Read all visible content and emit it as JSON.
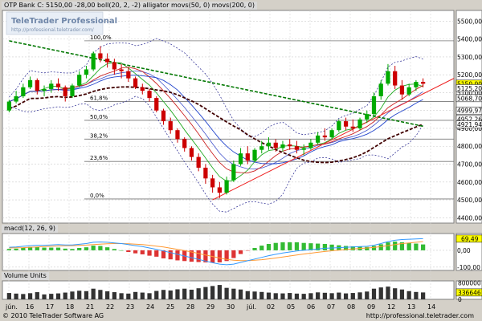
{
  "price_header": "OTP Bank C: 5150,00 -28,00 boll(20, 2, -2) alligator movs(50, 0) movs(200, 0)",
  "macd_header": "macd(12, 26, 9)",
  "volume_header": "Volume Units",
  "watermark": {
    "title": "TeleTrader Professional",
    "subtitle": "http://professional.teletrader.com/"
  },
  "footer": {
    "left": "© 2010 TeleTrader Software AG",
    "right": "http://professional.teletrader.com"
  },
  "colors": {
    "background": "#d4d0c8",
    "pane": "#ffffff",
    "candle_up": "#00aa00",
    "candle_down": "#cc0000",
    "bollinger": "#3a3a9a",
    "movs50": "#400000",
    "movs200": "#007700",
    "trendline": "#ee2222",
    "macd_line": "#3399ff",
    "signal_line": "#ff9933",
    "price_label": "#ffff00"
  },
  "chart_data": [
    {
      "type": "candlestick",
      "x_tick_labels": [
        "jún.",
        "16",
        "17",
        "18",
        "21",
        "22",
        "23",
        "24",
        "25",
        "28",
        "29",
        "30",
        "júl.",
        "02",
        "05",
        "06",
        "07",
        "08",
        "09",
        "12",
        "13",
        "14"
      ],
      "y_ticks": [
        4400,
        4500,
        4600,
        4700,
        4800,
        4900,
        5000,
        5100,
        5200,
        5300,
        5400,
        5500
      ],
      "y_tick_labels": [
        "4400,00",
        "4500,00",
        "4600,00",
        "4700,00",
        "4800,00",
        "4900,00",
        "5000,00",
        "5100,00",
        "5200,00",
        "5300,00",
        "5400,00",
        "5500,00"
      ],
      "ylim": [
        4370,
        5560
      ],
      "price_labels": [
        {
          "text": "5150,00",
          "value": 5150
        },
        {
          "text": "5125,20",
          "value": 5125
        },
        {
          "text": "5068,70",
          "value": 5069
        },
        {
          "text": "4999,97",
          "value": 5000
        },
        {
          "text": "4952,26",
          "value": 4952
        },
        {
          "text": "4921,94",
          "value": 4922
        }
      ],
      "fibonacci": [
        {
          "label": "100,0%",
          "value": 5390
        },
        {
          "label": "61,8%",
          "value": 5050
        },
        {
          "label": "50,0%",
          "value": 4945
        },
        {
          "label": "38,2%",
          "value": 4840
        },
        {
          "label": "23,6%",
          "value": 4715
        },
        {
          "label": "0,0%",
          "value": 4505
        }
      ],
      "candles": [
        [
          5000,
          5060,
          4990,
          5050
        ],
        [
          5050,
          5110,
          5040,
          5080
        ],
        [
          5080,
          5150,
          5070,
          5130
        ],
        [
          5130,
          5190,
          5120,
          5170
        ],
        [
          5170,
          5180,
          5090,
          5110
        ],
        [
          5110,
          5140,
          5080,
          5120
        ],
        [
          5120,
          5170,
          5100,
          5150
        ],
        [
          5150,
          5180,
          5110,
          5130
        ],
        [
          5130,
          5140,
          5050,
          5080
        ],
        [
          5080,
          5150,
          5070,
          5140
        ],
        [
          5140,
          5220,
          5130,
          5200
        ],
        [
          5200,
          5250,
          5180,
          5230
        ],
        [
          5230,
          5330,
          5220,
          5320
        ],
        [
          5320,
          5360,
          5270,
          5290
        ],
        [
          5290,
          5320,
          5240,
          5270
        ],
        [
          5270,
          5290,
          5200,
          5230
        ],
        [
          5230,
          5260,
          5180,
          5220
        ],
        [
          5220,
          5240,
          5160,
          5180
        ],
        [
          5180,
          5190,
          5120,
          5130
        ],
        [
          5130,
          5150,
          5090,
          5110
        ],
        [
          5110,
          5120,
          5050,
          5070
        ],
        [
          5070,
          5080,
          4990,
          5000
        ],
        [
          5000,
          5010,
          4920,
          4940
        ],
        [
          4940,
          4960,
          4870,
          4890
        ],
        [
          4890,
          4900,
          4820,
          4840
        ],
        [
          4840,
          4850,
          4770,
          4790
        ],
        [
          4790,
          4800,
          4720,
          4740
        ],
        [
          4740,
          4760,
          4660,
          4680
        ],
        [
          4680,
          4700,
          4590,
          4620
        ],
        [
          4620,
          4640,
          4540,
          4570
        ],
        [
          4570,
          4600,
          4510,
          4540
        ],
        [
          4540,
          4630,
          4530,
          4610
        ],
        [
          4610,
          4720,
          4600,
          4700
        ],
        [
          4700,
          4790,
          4690,
          4760
        ],
        [
          4760,
          4800,
          4700,
          4720
        ],
        [
          4720,
          4790,
          4710,
          4780
        ],
        [
          4780,
          4830,
          4760,
          4800
        ],
        [
          4800,
          4850,
          4780,
          4820
        ],
        [
          4820,
          4840,
          4770,
          4790
        ],
        [
          4790,
          4830,
          4770,
          4810
        ],
        [
          4810,
          4840,
          4780,
          4800
        ],
        [
          4800,
          4830,
          4760,
          4780
        ],
        [
          4780,
          4810,
          4750,
          4790
        ],
        [
          4790,
          4840,
          4780,
          4820
        ],
        [
          4820,
          4880,
          4810,
          4860
        ],
        [
          4860,
          4900,
          4830,
          4850
        ],
        [
          4850,
          4900,
          4840,
          4890
        ],
        [
          4890,
          4950,
          4880,
          4940
        ],
        [
          4940,
          4960,
          4890,
          4910
        ],
        [
          4910,
          4950,
          4880,
          4900
        ],
        [
          4900,
          4960,
          4890,
          4950
        ],
        [
          4950,
          5000,
          4930,
          4980
        ],
        [
          4980,
          5100,
          4970,
          5080
        ],
        [
          5080,
          5170,
          5060,
          5150
        ],
        [
          5150,
          5260,
          5140,
          5220
        ],
        [
          5220,
          5250,
          5120,
          5140
        ],
        [
          5140,
          5170,
          5060,
          5090
        ],
        [
          5090,
          5150,
          5080,
          5130
        ],
        [
          5130,
          5170,
          5110,
          5160
        ],
        [
          5160,
          5180,
          5130,
          5150
        ]
      ]
    },
    {
      "type": "macd",
      "y_ticks": [
        -100,
        0
      ],
      "y_tick_labels": [
        "-100,00",
        "0,00"
      ],
      "ylim": [
        -120,
        100
      ],
      "last_value_label": "69,49",
      "last_value": 69.49,
      "macd": [
        18,
        20,
        24,
        28,
        30,
        30,
        32,
        34,
        32,
        32,
        36,
        40,
        48,
        50,
        48,
        44,
        40,
        34,
        28,
        22,
        14,
        6,
        -4,
        -14,
        -24,
        -34,
        -44,
        -54,
        -64,
        -74,
        -82,
        -86,
        -82,
        -72,
        -62,
        -52,
        -42,
        -32,
        -24,
        -16,
        -10,
        -4,
        0,
        4,
        8,
        12,
        14,
        16,
        18,
        20,
        22,
        24,
        30,
        40,
        52,
        60,
        64,
        66,
        68,
        69.49
      ],
      "signal": [
        14,
        15,
        16,
        18,
        20,
        22,
        24,
        26,
        27,
        28,
        29,
        31,
        34,
        37,
        39,
        40,
        40,
        39,
        37,
        34,
        30,
        25,
        20,
        13,
        6,
        -2,
        -10,
        -19,
        -28,
        -37,
        -46,
        -54,
        -59,
        -61,
        -61,
        -59,
        -56,
        -51,
        -46,
        -40,
        -34,
        -28,
        -22,
        -17,
        -12,
        -7,
        -3,
        1,
        5,
        8,
        11,
        14,
        17,
        22,
        28,
        34,
        40,
        44,
        48,
        52
      ]
    },
    {
      "type": "bar",
      "series": [
        {
          "name": "Volume Units",
          "values": [
            310000,
            280000,
            260000,
            300000,
            350000,
            240000,
            270000,
            290000,
            330000,
            380000,
            420000,
            400000,
            520000,
            460000,
            390000,
            350000,
            300000,
            280000,
            360000,
            330000,
            300000,
            410000,
            460000,
            430000,
            490000,
            520000,
            470000,
            540000,
            600000,
            650000,
            700000,
            560000,
            520000,
            480000,
            400000,
            380000,
            360000,
            330000,
            300000,
            290000,
            310000,
            280000,
            270000,
            300000,
            340000,
            320000,
            300000,
            330000,
            290000,
            310000,
            340000,
            380000,
            520000,
            580000,
            620000,
            540000,
            480000,
            400000,
            360000,
            336646
          ]
        }
      ],
      "y_ticks": [
        0,
        800000
      ],
      "y_tick_labels": [
        "0",
        "800000"
      ],
      "ylim": [
        0,
        900000
      ],
      "last_value_label": "336646",
      "last_value": 336646
    }
  ]
}
